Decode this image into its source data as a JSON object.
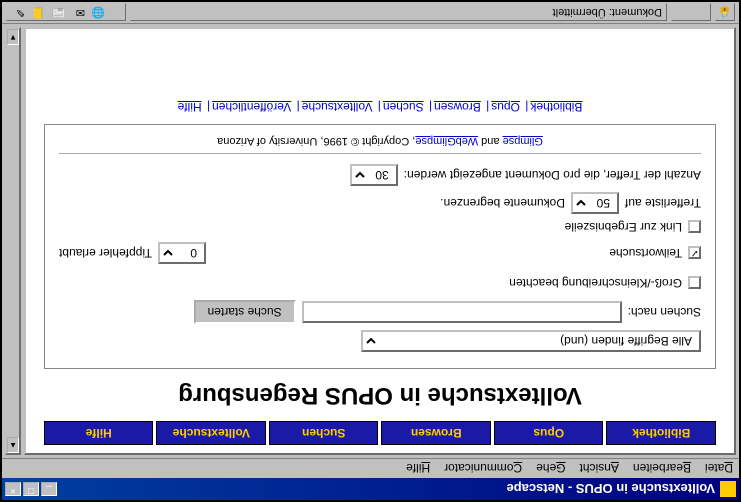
{
  "window": {
    "title": "Volltextsuche in OPUS - Netscape",
    "controls": {
      "min": "_",
      "max": "□",
      "close": "×"
    }
  },
  "menubar": [
    "Datei",
    "Bearbeiten",
    "Ansicht",
    "Gehe",
    "Communicator",
    "Hilfe"
  ],
  "nav_buttons": [
    "Bibliothek",
    "Opus",
    "Browsen",
    "Suchen",
    "Volltextsuche",
    "Hilfe"
  ],
  "heading": "Volltextsuche in OPUS Regensburg",
  "form": {
    "match_mode_selected": "Alle Begriffe finden (und)",
    "search_label": "Suchen nach:",
    "search_value": "",
    "submit_label": "Suche starten",
    "cb_case": "Groß-/Kleinschreibung beachten",
    "cb_partial": "Teilwortsuche",
    "cb_partial_checked": true,
    "typos_value": "0",
    "typos_label": "Tippfehler erlaubt",
    "cb_link": "Link zur Ergebniszeile",
    "limit_label_pre": "Trefferliste auf",
    "limit_value": "50",
    "limit_label_post": "Dokumente begrenzen.",
    "perdoc_label": "Anzahl der Treffer, die pro Dokument angezeigt werden:",
    "perdoc_value": "30"
  },
  "credits": {
    "link1": "Glimpse",
    "mid": " and ",
    "link2": "WebGlimpse",
    "rest": ", Copyright © 1996, University of Arizona"
  },
  "bottom_nav": [
    "Bibliothek",
    "Opus",
    "Browsen",
    "Suchen",
    "Volltextsuche",
    "Veröffentlichen",
    "Hilfe"
  ],
  "statusbar": {
    "text": "Dokument: Übermittelt"
  }
}
